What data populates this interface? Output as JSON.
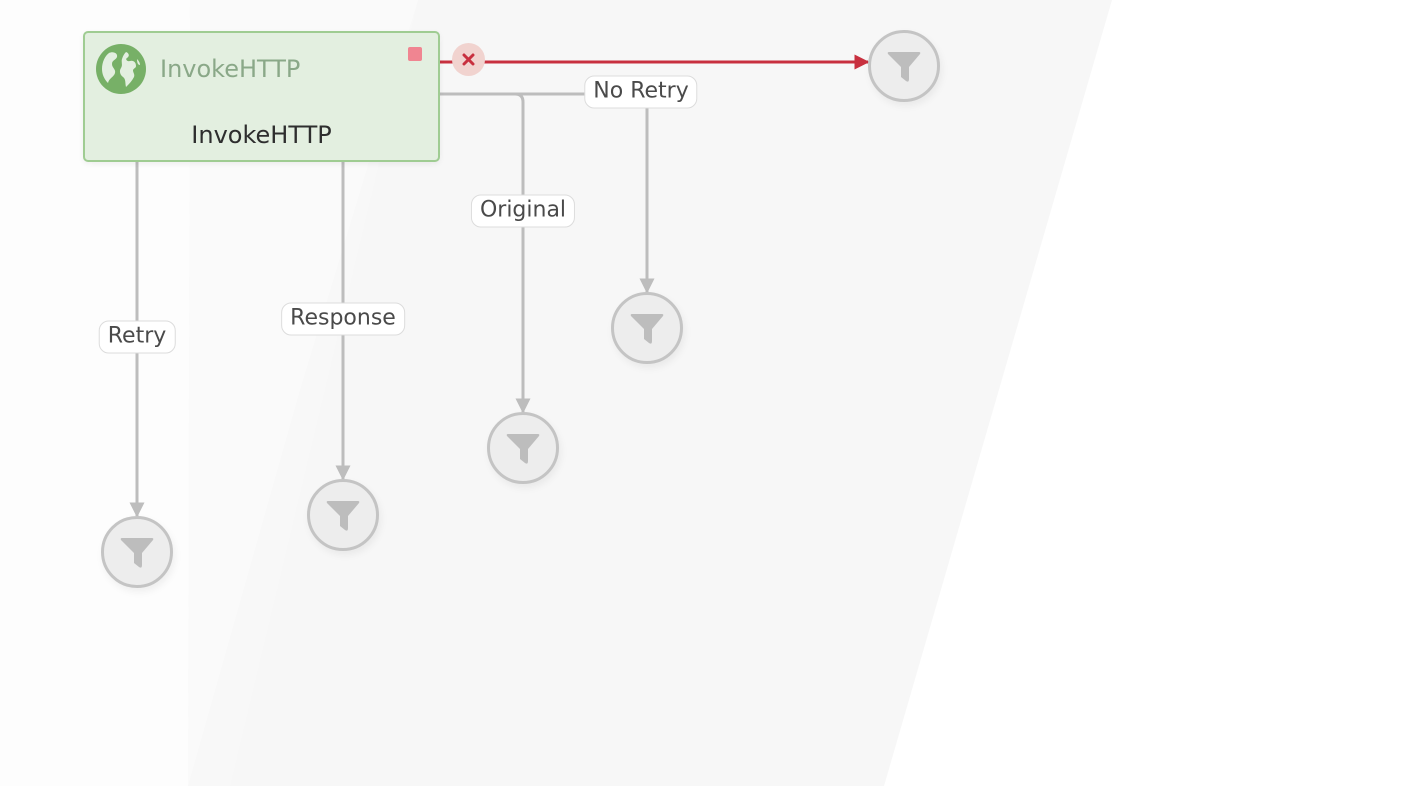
{
  "processor": {
    "type_label": "InvokeHTTP",
    "name": "InvokeHTTP",
    "icon": "globe-icon",
    "status": "stopped",
    "colors": {
      "fill": "#e3efe0",
      "border": "#9fcc92",
      "icon": "#77b067",
      "status": "#f08591"
    }
  },
  "connections": [
    {
      "id": "failure",
      "label": "",
      "type": "error",
      "color": "#c8303f",
      "icon": "close-icon",
      "target": "funnel-1"
    },
    {
      "id": "no-retry",
      "label": "No Retry",
      "type": "normal",
      "color": "#bdbdbd",
      "target": "funnel-2"
    },
    {
      "id": "original",
      "label": "Original",
      "type": "normal",
      "color": "#bdbdbd",
      "target": "funnel-3"
    },
    {
      "id": "response",
      "label": "Response",
      "type": "normal",
      "color": "#bdbdbd",
      "target": "funnel-4"
    },
    {
      "id": "retry",
      "label": "Retry",
      "type": "normal",
      "color": "#bdbdbd",
      "target": "funnel-5"
    }
  ],
  "funnels": [
    {
      "id": "funnel-1",
      "icon": "funnel-icon"
    },
    {
      "id": "funnel-2",
      "icon": "funnel-icon"
    },
    {
      "id": "funnel-3",
      "icon": "funnel-icon"
    },
    {
      "id": "funnel-4",
      "icon": "funnel-icon"
    },
    {
      "id": "funnel-5",
      "icon": "funnel-icon"
    }
  ]
}
